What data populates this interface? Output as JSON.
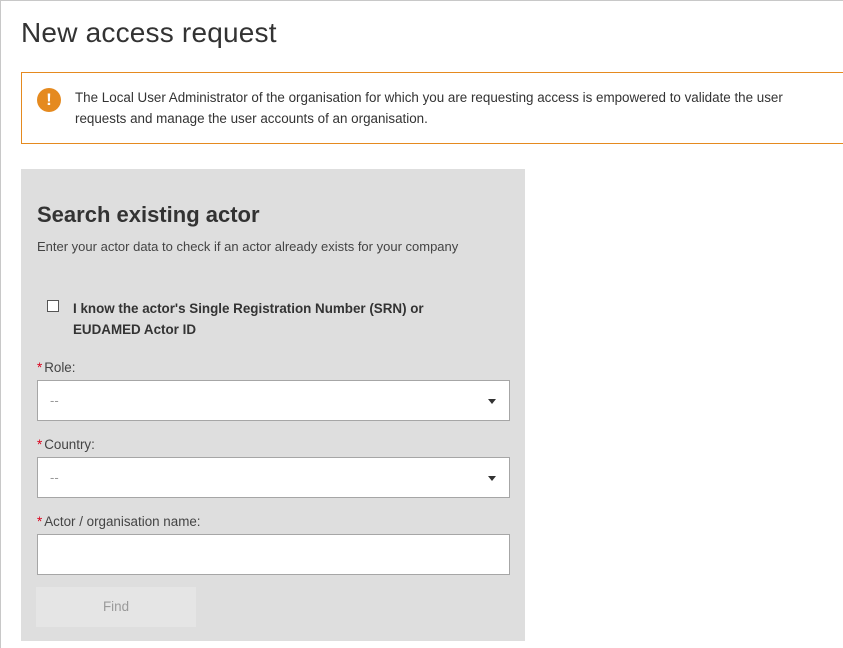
{
  "page": {
    "title": "New access request"
  },
  "notice": {
    "icon": "exclamation-circle-icon",
    "icon_glyph": "!",
    "accent_color": "#e58a1f",
    "text": "The Local User Administrator of the organisation for which you are requesting access is empowered to validate the user requests and manage the user accounts of an organisation."
  },
  "search": {
    "title": "Search existing actor",
    "subtitle": "Enter your actor data to check if an actor already exists for your company",
    "srn_checkbox": {
      "label": "I know the actor's Single Registration Number (SRN) or EUDAMED Actor ID",
      "checked": false
    },
    "required_marker": "*",
    "role": {
      "label": "Role:",
      "value": "--"
    },
    "country": {
      "label": "Country:",
      "value": "--"
    },
    "name": {
      "label": "Actor / organisation name:",
      "value": ""
    },
    "find_label": "Find"
  }
}
